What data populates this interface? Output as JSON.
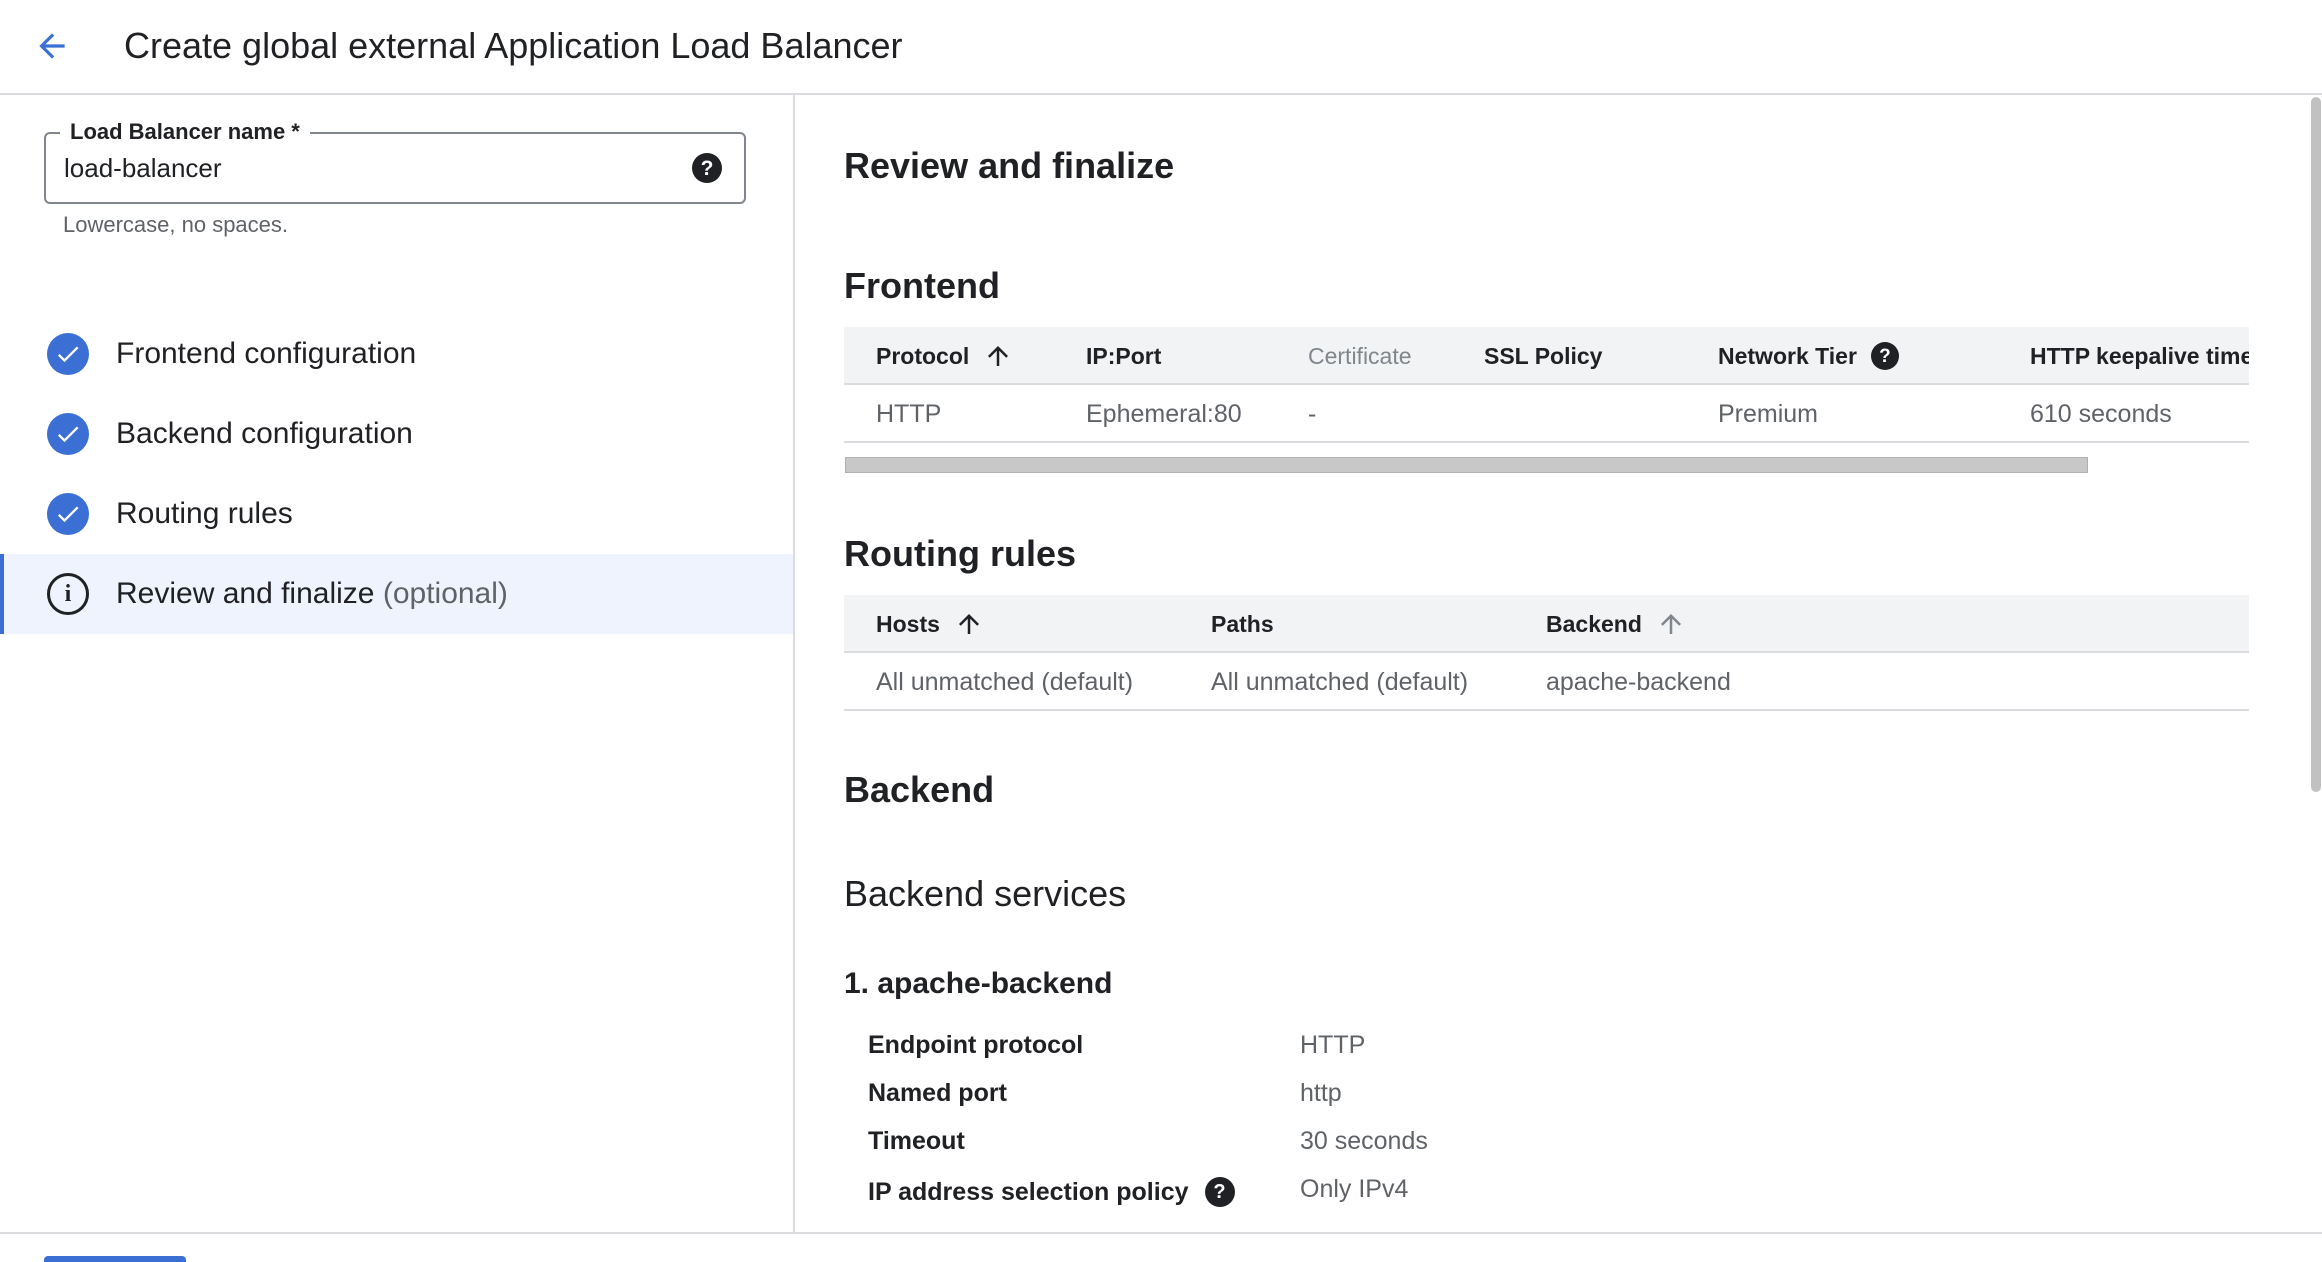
{
  "header": {
    "title": "Create global external Application Load Balancer",
    "back_icon": "arrow-back-icon"
  },
  "sidebar": {
    "name_field": {
      "label": "Load Balancer name *",
      "value": "load-balancer",
      "hint": "Lowercase, no spaces."
    },
    "steps": [
      {
        "label": "Frontend configuration",
        "status": "complete"
      },
      {
        "label": "Backend configuration",
        "status": "complete"
      },
      {
        "label": "Routing rules",
        "status": "complete"
      },
      {
        "label": "Review and finalize",
        "suffix": "(optional)",
        "status": "active"
      }
    ]
  },
  "main": {
    "title": "Review and finalize",
    "frontend": {
      "heading": "Frontend",
      "columns": [
        "Protocol",
        "IP:Port",
        "Certificate",
        "SSL Policy",
        "Network Tier",
        "HTTP keepalive time"
      ],
      "rows": [
        [
          "HTTP",
          "Ephemeral:80",
          "-",
          "",
          "Premium",
          "610 seconds"
        ]
      ]
    },
    "routing": {
      "heading": "Routing rules",
      "columns": [
        "Hosts",
        "Paths",
        "Backend"
      ],
      "rows": [
        [
          "All unmatched (default)",
          "All unmatched (default)",
          "apache-backend"
        ]
      ]
    },
    "backend": {
      "heading": "Backend",
      "services_heading": "Backend services",
      "service_title": "1. apache-backend",
      "details": [
        {
          "key": "Endpoint protocol",
          "value": "HTTP"
        },
        {
          "key": "Named port",
          "value": "http"
        },
        {
          "key": "Timeout",
          "value": "30 seconds"
        },
        {
          "key": "IP address selection policy",
          "value": "Only IPv4"
        }
      ]
    }
  },
  "colors": {
    "accent": "#3b6fd4",
    "active_bg": "#eef3fd",
    "divider": "#dadce0",
    "muted_text": "#5f6368"
  }
}
